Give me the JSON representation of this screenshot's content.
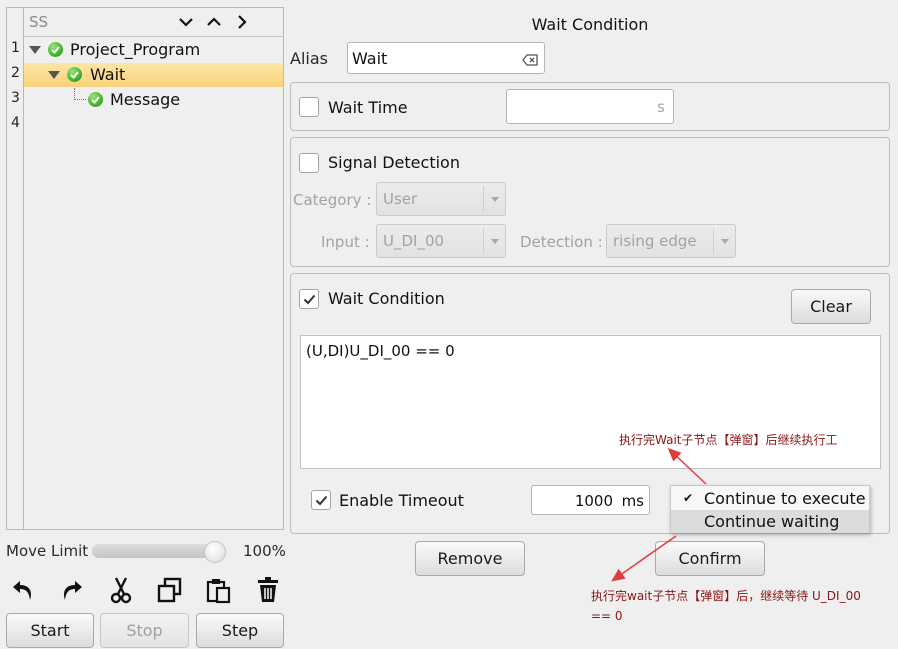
{
  "tree": {
    "header_title": "SS",
    "line_numbers": [
      "1",
      "2",
      "3",
      "4"
    ],
    "nodes": [
      {
        "label": "Project_Program"
      },
      {
        "label": "Wait"
      },
      {
        "label": "Message"
      }
    ],
    "header_icons": [
      "chevron-down-icon",
      "chevron-up-icon",
      "chevron-right-icon"
    ]
  },
  "move_limit": {
    "label": "Move Limit",
    "value_text": "100%",
    "value": 1.0
  },
  "toolbar_icons": [
    "undo-icon",
    "redo-icon",
    "cut-icon",
    "copy-icon",
    "paste-icon",
    "trash-icon"
  ],
  "controls": {
    "start": "Start",
    "stop": "Stop",
    "step": "Step"
  },
  "panel": {
    "title": "Wait Condition",
    "alias_label": "Alias",
    "alias_value": "Wait",
    "wait_time": {
      "label": "Wait Time",
      "unit": "s",
      "value": "",
      "checked": false
    },
    "signal_detection": {
      "label": "Signal Detection",
      "checked": false,
      "category_label": "Category :",
      "category_value": "User",
      "input_label": "Input :",
      "input_value": "U_DI_00",
      "detection_label": "Detection :",
      "detection_value": "rising edge"
    },
    "wait_condition": {
      "label": "Wait Condition",
      "checked": true,
      "clear": "Clear",
      "expression": "(U,DI)U_DI_00 == 0"
    },
    "timeout": {
      "label": "Enable Timeout",
      "checked": true,
      "value": "1000",
      "unit": "ms"
    },
    "menu": {
      "items": [
        "Continue to execute",
        "Continue waiting"
      ],
      "selected_index": 0
    },
    "remove": "Remove",
    "confirm": "Confirm"
  },
  "annotations": {
    "note1": "执行完Wait子节点【弹窗】后继续执行工",
    "note2_line1": "执行完wait子节点【弹窗】后，继续等待 U_DI_00",
    "note2_line2": "== 0",
    "color": "#8b1414"
  }
}
